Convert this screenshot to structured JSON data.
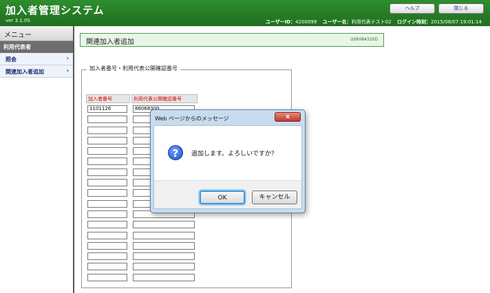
{
  "header": {
    "app_title": "加入者管理システム",
    "version": "ver 3.1.0S",
    "help_label": "ヘルプ",
    "close_label": "閉じる",
    "user_id_label": "ユーザーID：",
    "user_id": "4200099",
    "user_name_label": "ユーザー名：",
    "user_name": "利用代表テスト02",
    "login_time_label": "ログイン時刻：",
    "login_time": "2015/08/07 19:01:14"
  },
  "sidebar": {
    "title": "メニュー",
    "group": "利用代表者",
    "items": [
      {
        "label": "照会",
        "arrow": "›"
      },
      {
        "label": "関連加入者追加",
        "arrow": "›"
      }
    ]
  },
  "main": {
    "page_title": "関連加入者追加",
    "page_id": "USR084320D",
    "fieldset_legend": "加入者番号・利用代表公開確認番号",
    "col1_header": "加入者番号",
    "col2_header": "利用代表公開確認番号",
    "row1_col1": "1101126",
    "row1_col2": "86068300"
  },
  "dialog": {
    "title": "Web ページからのメッセージ",
    "close_symbol": "x",
    "icon_glyph": "?",
    "message": "追加します。よろしいですか？",
    "ok_label": "OK",
    "cancel_label": "キャンセル"
  }
}
